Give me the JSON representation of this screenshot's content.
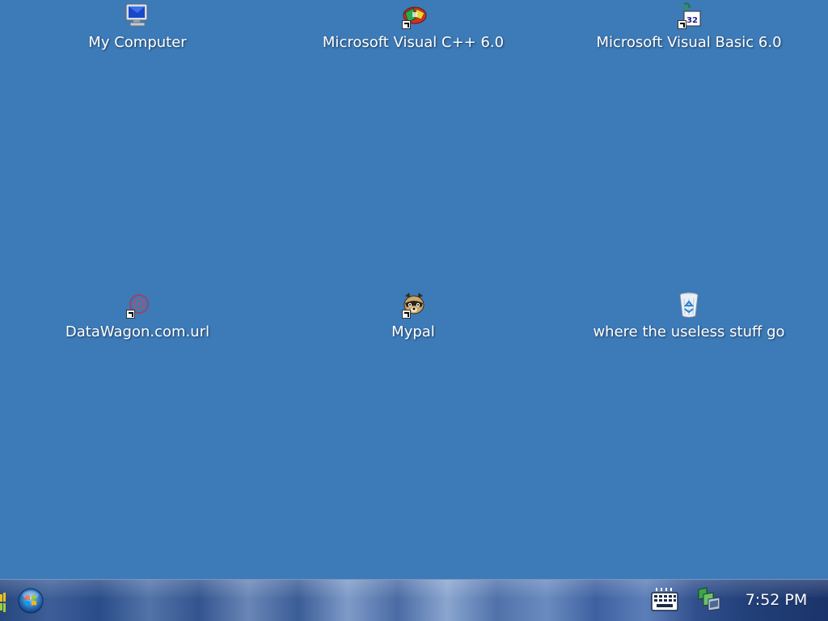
{
  "desktop": {
    "background_color": "#3c7ab8",
    "icons": [
      {
        "label": "My Computer",
        "icon": "my-computer-icon",
        "shortcut": false
      },
      {
        "label": "Microsoft Visual C++ 6.0",
        "icon": "visual-cpp-icon",
        "shortcut": true
      },
      {
        "label": "Microsoft Visual Basic 6.0",
        "icon": "visual-basic-icon",
        "shortcut": true
      },
      {
        "label": "DataWagon.com.url",
        "icon": "internet-shortcut-icon",
        "shortcut": true
      },
      {
        "label": "Mypal",
        "icon": "raccoon-browser-icon",
        "shortcut": true
      },
      {
        "label": "where the useless stuff go",
        "icon": "recycle-bin-icon",
        "shortcut": false
      }
    ]
  },
  "taskbar": {
    "start_icon": "start-orb-icon",
    "tray": {
      "keyboard_icon": "keyboard-icon",
      "network_icon": "network-icon",
      "clock": "7:52 PM"
    }
  }
}
